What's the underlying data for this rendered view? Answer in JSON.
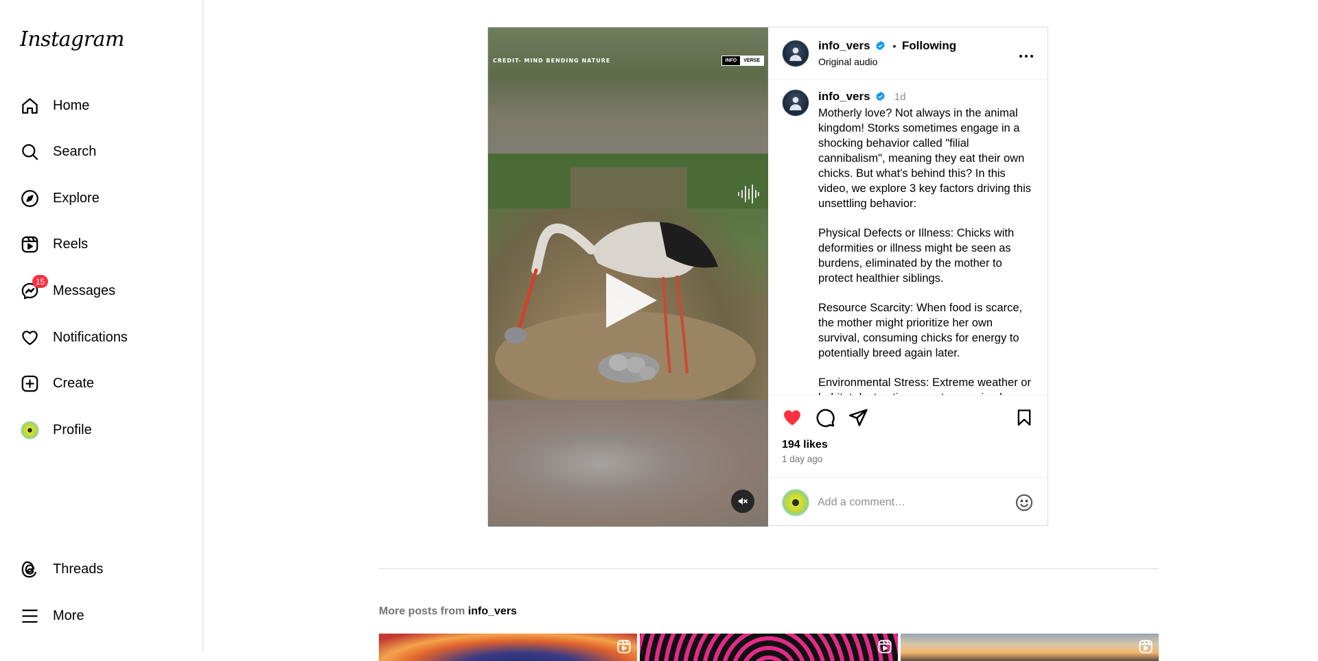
{
  "sidebar": {
    "logo": "Instagram",
    "items": [
      {
        "label": "Home",
        "icon": "home-icon"
      },
      {
        "label": "Search",
        "icon": "search-icon"
      },
      {
        "label": "Explore",
        "icon": "explore-icon"
      },
      {
        "label": "Reels",
        "icon": "reels-icon"
      },
      {
        "label": "Messages",
        "icon": "messenger-icon",
        "badge": "15"
      },
      {
        "label": "Notifications",
        "icon": "heart-icon"
      },
      {
        "label": "Create",
        "icon": "plus-square-icon"
      },
      {
        "label": "Profile",
        "icon": "profile-avatar"
      }
    ],
    "bottom": [
      {
        "label": "Threads",
        "icon": "threads-icon"
      },
      {
        "label": "More",
        "icon": "hamburger-icon"
      }
    ]
  },
  "post": {
    "media": {
      "credit": "CREDIT- MIND BENDING NATURE",
      "brand_left": "INFO",
      "brand_right": "VERSE"
    },
    "header": {
      "username": "info_vers",
      "following": "Following",
      "audio": "Original audio"
    },
    "caption": {
      "username": "info_vers",
      "age": "1d",
      "paragraphs": [
        "Motherly love? Not always in the animal kingdom! Storks sometimes engage in a shocking behavior called \"filial cannibalism\", meaning they eat their own chicks. But what's behind this? In this video, we explore 3 key factors driving this unsettling behavior:",
        "Physical Defects or Illness: Chicks with deformities or illness might be seen as burdens, eliminated by the mother to protect healthier siblings.",
        "Resource Scarcity: When food is scarce, the mother might prioritize her own survival, consuming chicks for energy to potentially breed again later.",
        "Environmental Stress: Extreme weather or habitat destruction can stress animals"
      ]
    },
    "likes": "194 likes",
    "time": "1 day ago",
    "comment_placeholder": "Add a comment…",
    "liked": true
  },
  "more_posts": {
    "prefix": "More posts from",
    "username": "info_vers"
  },
  "colors": {
    "like_red": "#ff3040",
    "verified_blue": "#0095f6",
    "border": "#dbdbdb"
  }
}
